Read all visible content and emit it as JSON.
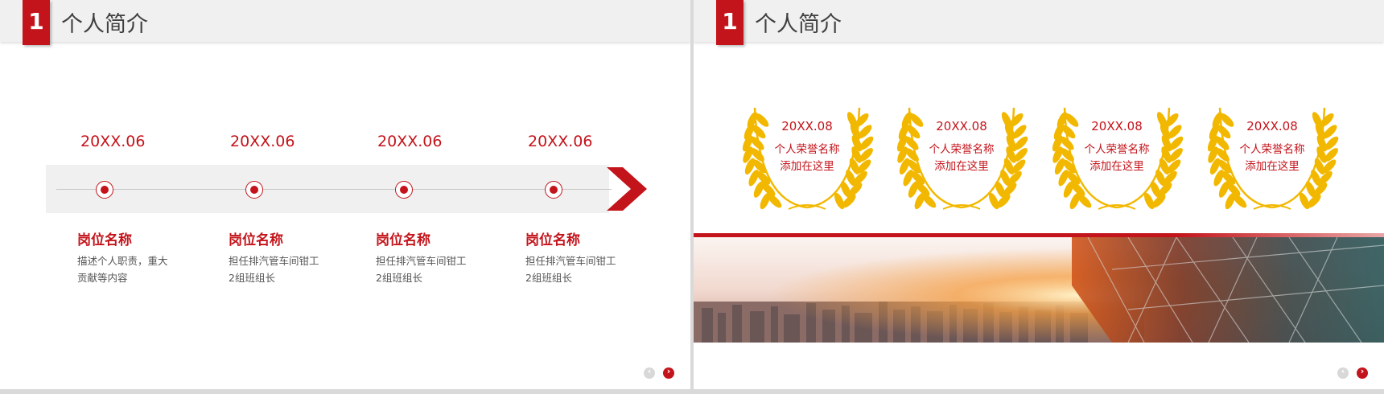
{
  "slides": [
    {
      "number": "1",
      "title": "个人简介",
      "timeline": [
        {
          "date": "20XX.06",
          "post": "岗位名称",
          "desc": "描述个人职责，重大贡献等内容"
        },
        {
          "date": "20XX.06",
          "post": "岗位名称",
          "desc": "担任排汽管车间钳工2组班组长"
        },
        {
          "date": "20XX.06",
          "post": "岗位名称",
          "desc": "担任排汽管车间钳工2组班组长"
        },
        {
          "date": "20XX.06",
          "post": "岗位名称",
          "desc": "担任排汽管车间钳工2组班组长"
        }
      ]
    },
    {
      "number": "1",
      "title": "个人简介",
      "honors": [
        {
          "date": "20XX.08",
          "name_line1": "个人荣誉名称",
          "name_line2": "添加在这里"
        },
        {
          "date": "20XX.08",
          "name_line1": "个人荣誉名称",
          "name_line2": "添加在这里"
        },
        {
          "date": "20XX.08",
          "name_line1": "个人荣誉名称",
          "name_line2": "添加在这里"
        },
        {
          "date": "20XX.08",
          "name_line1": "个人荣誉名称",
          "name_line2": "添加在这里"
        }
      ]
    }
  ],
  "nav": {
    "prev_icon": "chevron-left-icon",
    "next_icon": "chevron-right-icon"
  },
  "colors": {
    "accent": "#c4141b",
    "wheat": "#f2b800",
    "header_bg": "#f0f0f0"
  }
}
